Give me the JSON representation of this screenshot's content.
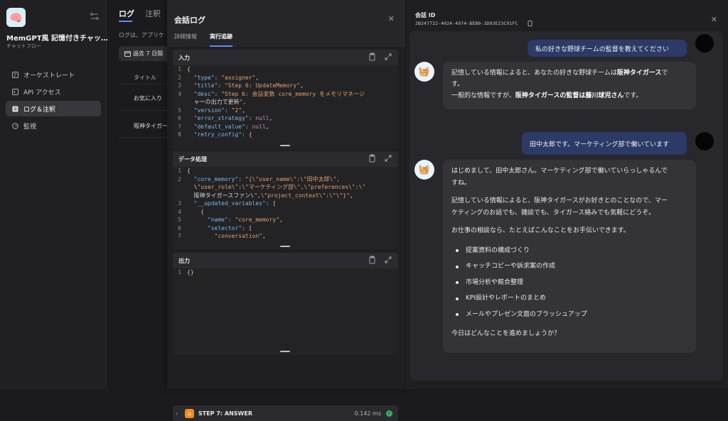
{
  "app": {
    "icon": "brain-icon",
    "title": "MemGPT風 記憶付きチャッ…",
    "subtitle": "チャットフロー"
  },
  "sidebar": {
    "items": [
      {
        "label": "オーケストレート",
        "icon": "orchestrate-icon"
      },
      {
        "label": "API アクセス",
        "icon": "terminal-icon"
      },
      {
        "label": "ログ＆注釈",
        "icon": "document-icon",
        "active": true
      },
      {
        "label": "監視",
        "icon": "monitor-icon"
      }
    ]
  },
  "loglist": {
    "tab_log": "ログ",
    "tab_annotation": "注釈",
    "description": "ログは、アプリケ",
    "period_button": "過去 7 日間",
    "col_title": "タイトル",
    "rows": [
      "お気に入り",
      "阪神タイガー"
    ]
  },
  "dialog": {
    "title": "会話ログ",
    "tab_detail": "詳細情報",
    "tab_trace": "実行追跡",
    "input_panel": {
      "label": "入力",
      "lines": [
        {
          "n": "1",
          "text": "{"
        },
        {
          "n": "2",
          "text": "  \"type\": \"assigner\","
        },
        {
          "n": "3",
          "text": "  \"title\": \"Step 6: UpdateMemory\","
        },
        {
          "n": "4",
          "text": "  \"desc\": \"Step 6: 会話変数 core_memory をメモリマネージ"
        },
        {
          "n": "",
          "text": "  ャーの出力で更新\","
        },
        {
          "n": "5",
          "text": "  \"version\": \"2\","
        },
        {
          "n": "6",
          "text": "  \"error_strategy\": null,"
        },
        {
          "n": "7",
          "text": "  \"default_value\": null,"
        },
        {
          "n": "8",
          "text": "  \"retry_config\": {"
        }
      ]
    },
    "process_panel": {
      "label": "データ処理",
      "lines": [
        {
          "n": "1",
          "text": "{"
        },
        {
          "n": "2",
          "text": "  \"core_memory\": \"{\\\"user_name\\\":\\\"田中太郎\\\","
        },
        {
          "n": "",
          "text": "  \\\"user_role\\\":\\\"マーケティング部\\\",\\\"preferences\\\":\\\""
        },
        {
          "n": "",
          "text": "  阪神タイガースファン\\\",\\\"project_context\\\":\\\"\\\"}\","
        },
        {
          "n": "3",
          "text": "  \"__updated_variables\": ["
        },
        {
          "n": "4",
          "text": "    {"
        },
        {
          "n": "5",
          "text": "      \"name\": \"core_memory\","
        },
        {
          "n": "6",
          "text": "      \"selector\": ["
        },
        {
          "n": "7",
          "text": "        \"conversation\","
        }
      ]
    },
    "output_panel": {
      "label": "出力",
      "lines": [
        {
          "n": "1",
          "text": "{}"
        }
      ]
    },
    "step7": {
      "name": "STEP 7: ANSWER",
      "time": "0.142 ms"
    }
  },
  "conversation": {
    "id_label": "会話 ID",
    "id": "2B247722-4024-4974-BEB0-3D93E23C91FC",
    "user_msg_1": "私の好きな野球チームの監督を教えてください",
    "bot_msg_1": {
      "line1_pre": "記憶している情報によると、あなたの好きな野球チームは",
      "line1_bold": "阪神タイガース",
      "line1_post": "で",
      "line2": "す。",
      "line3_pre": "一般的な情報ですが、",
      "line3_bold": "阪神タイガースの監督は藤川球児さん",
      "line3_post": "です。"
    },
    "user_msg_2": "田中太郎です。マーケティング部で働いています",
    "bot_msg_2": {
      "p1a": "はじめまして、田中太郎さん。マーケティング部で働いていらっしゃるんで",
      "p1b": "すね。",
      "p2a": "記憶している情報によると、阪神タイガースがお好きとのことなので、マー",
      "p2b": "ケティングのお話でも、雑談でも、タイガース絡みでも気軽にどうぞ。",
      "p3": "お仕事の相談なら、たとえばこんなことをお手伝いできます。",
      "bullets": [
        "提案資料の構成づくり",
        "キャッチコピーや訴求案の作成",
        "市場分析や競合整理",
        "KPI設計やレポートのまとめ",
        "メールやプレゼン文面のブラッシュアップ"
      ],
      "p4": "今日はどんなことを進めましょうか？"
    }
  }
}
